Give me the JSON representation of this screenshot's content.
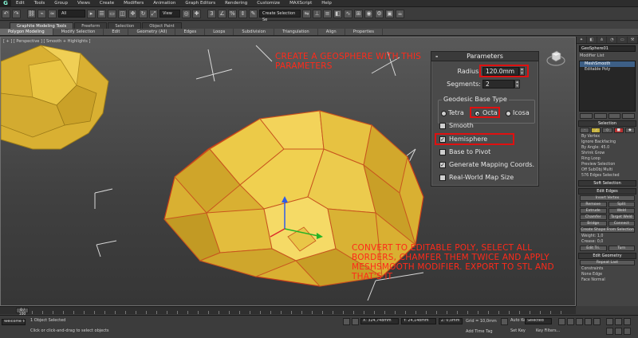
{
  "menubar": {
    "logo": "G",
    "items": [
      "Edit",
      "Tools",
      "Group",
      "Views",
      "Create",
      "Modifiers",
      "Animation",
      "Graph Editors",
      "Rendering",
      "Customize",
      "MAXScript",
      "Help"
    ]
  },
  "toolbar": {
    "selection_filter": "All",
    "ref_coord": "View",
    "named_selection": "Create Selection Se"
  },
  "ribbon": {
    "tabs": [
      "Graphite Modeling Tools",
      "Freeform",
      "Selection",
      "Object Paint"
    ],
    "active_tab": 0,
    "panels": [
      "Polygon Modeling",
      "Modify Selection",
      "Edit",
      "Geometry (All)",
      "Edges",
      "Loops",
      "Subdivision",
      "Triangulation",
      "Align",
      "Properties"
    ]
  },
  "viewport": {
    "label": "[ + ] [ Perspective ] [ Smooth + Highlights ]",
    "note_top": "CREATE A GEOSPHERE WITH THIS PARAMETERS",
    "note_bottom": "CONVERT TO EDITABLE POLY, SELECT ALL BORDERS, CHAMFER THEM TWICE AND APPLY MESHSMOOTH MODIFIER. EXPORT TO STL AND THAT'S IT"
  },
  "params": {
    "title": "Parameters",
    "collapse": "-",
    "radius_label": "Radius:",
    "radius_value": "120.0mm",
    "segments_label": "Segments:",
    "segments_value": "2",
    "base_type_label": "Geodesic Base Type",
    "base_types": [
      "Tetra",
      "Octa",
      "Icosa"
    ],
    "base_type_selected": "Octa",
    "smooth_label": "Smooth",
    "smooth_checked": false,
    "hemisphere_label": "Hemisphere",
    "hemisphere_checked": true,
    "pivot_label": "Base to Pivot",
    "pivot_checked": false,
    "mapping_label": "Generate Mapping Coords.",
    "mapping_checked": true,
    "realworld_label": "Real-World Map Size",
    "realworld_checked": false,
    "check_glyph": "✓"
  },
  "command_panel": {
    "object_name": "GeoSphere01",
    "modifier_list": "Modifier List",
    "stack": [
      "MeshSmooth",
      "Editable Poly"
    ],
    "selection_head": "Selection",
    "selection_lines": [
      "By Vertex",
      "Ignore Backfacing",
      "By Angle: 45.0",
      "Shrink    Grow",
      "Ring    Loop",
      "Preview Selection",
      "Off   SubObj   Multi",
      "576 Edges Selected"
    ],
    "soft_selection": "Soft Selection",
    "edit_edges": "Edit Edges",
    "edit_edges_btns": [
      [
        "Insert Vertex"
      ],
      [
        "Remove",
        "Split"
      ],
      [
        "Extrude",
        "Weld"
      ],
      [
        "Chamfer",
        "Target Weld"
      ],
      [
        "Bridge",
        "Connect"
      ]
    ],
    "create_shape": "Create Shape From Selection",
    "weight": "Weight: 1,0",
    "crease": "Crease: 0,0",
    "edit_tri": [
      "Edit Tri.",
      "Turn"
    ],
    "edit_geometry": "Edit Geometry",
    "repeat_last": "Repeat Last",
    "constraints": "Constraints",
    "constraint_opts": [
      "None",
      "Edge",
      "Face",
      "Normal"
    ]
  },
  "timeline": {
    "frame": "0 / 100"
  },
  "statusbar": {
    "selection_msg": "1 Object Selected",
    "prompt_msg": "Click or click-and-drag to select objects",
    "welcome": "Welcome to M",
    "x_value": "X: 324,748mm",
    "y_value": "Y: 24,148mm",
    "z_value": "Z: 0,0mm",
    "grid_value": "Grid = 10,0mm",
    "autokey": "Auto Key",
    "setkey": "Set Key",
    "selected": "Selected",
    "key_filters": "Key Filters...",
    "add_time_tag": "Add Time Tag"
  },
  "colors": {
    "geometry": "#e6bf3a",
    "annotation": "#ff2a1a",
    "highlight_box": "#e01010"
  }
}
